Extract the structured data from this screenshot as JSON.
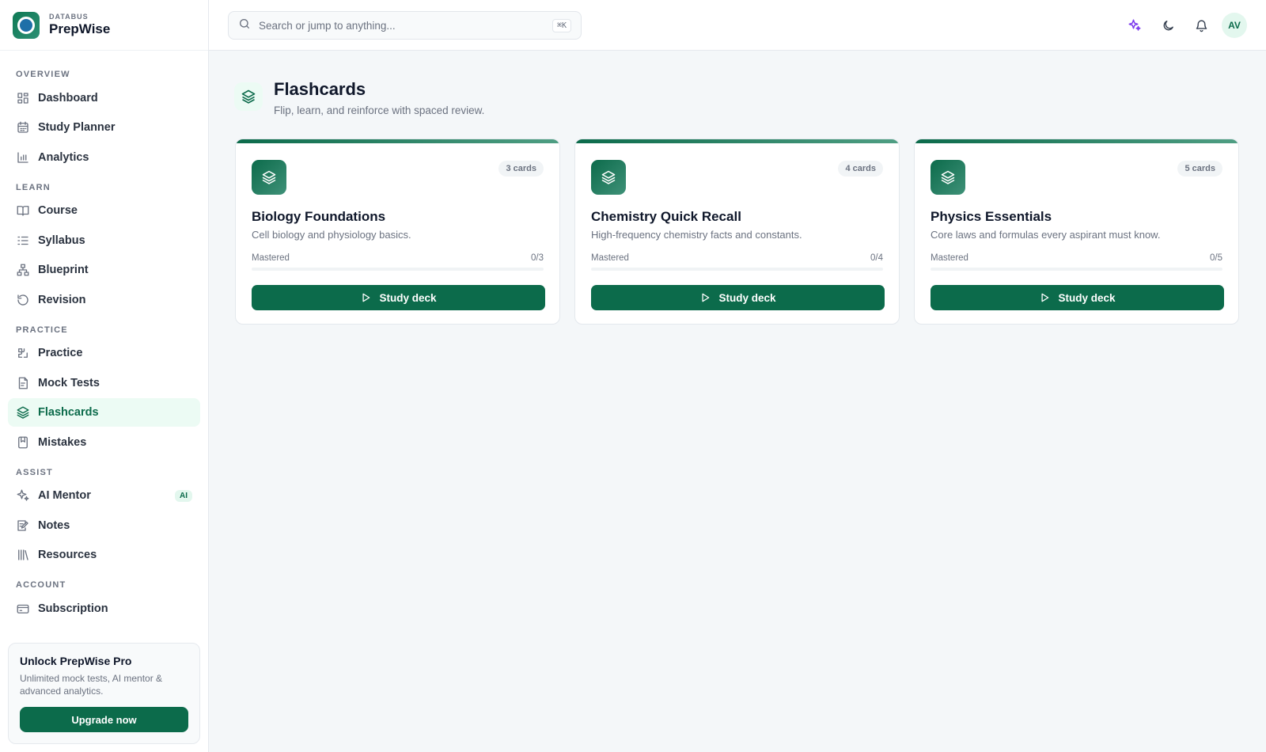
{
  "brand": {
    "kicker": "DATABUS",
    "name": "PrepWise"
  },
  "search": {
    "placeholder": "Search or jump to anything...",
    "shortcut": "⌘K"
  },
  "header": {
    "avatar_initials": "AV",
    "accent_color": "#7c3aed"
  },
  "sidebar": {
    "sections": [
      {
        "title": "OVERVIEW",
        "items": [
          {
            "label": "Dashboard",
            "icon": "dashboard-icon"
          },
          {
            "label": "Study Planner",
            "icon": "calendar-icon"
          },
          {
            "label": "Analytics",
            "icon": "bar-chart-icon"
          }
        ]
      },
      {
        "title": "LEARN",
        "items": [
          {
            "label": "Course",
            "icon": "book-icon"
          },
          {
            "label": "Syllabus",
            "icon": "list-icon"
          },
          {
            "label": "Blueprint",
            "icon": "sitemap-icon"
          },
          {
            "label": "Revision",
            "icon": "refresh-icon"
          }
        ]
      },
      {
        "title": "PRACTICE",
        "items": [
          {
            "label": "Practice",
            "icon": "puzzle-icon"
          },
          {
            "label": "Mock Tests",
            "icon": "document-icon"
          },
          {
            "label": "Flashcards",
            "icon": "layers-icon",
            "active": true
          },
          {
            "label": "Mistakes",
            "icon": "bookmark-icon"
          }
        ]
      },
      {
        "title": "ASSIST",
        "items": [
          {
            "label": "AI Mentor",
            "icon": "sparkles-icon",
            "badge": "AI"
          },
          {
            "label": "Notes",
            "icon": "note-icon"
          },
          {
            "label": "Resources",
            "icon": "library-icon"
          }
        ]
      },
      {
        "title": "ACCOUNT",
        "items": [
          {
            "label": "Subscription",
            "icon": "credit-card-icon"
          }
        ]
      }
    ]
  },
  "promo": {
    "title": "Unlock PrepWise Pro",
    "text": "Unlimited mock tests, AI mentor & advanced analytics.",
    "button": "Upgrade now"
  },
  "page": {
    "title": "Flashcards",
    "subtitle": "Flip, learn, and reinforce with spaced review."
  },
  "decks": [
    {
      "count": "3 cards",
      "title": "Biology Foundations",
      "desc": "Cell biology and physiology basics.",
      "progress_label": "Mastered",
      "progress_value": "0/3",
      "progress_fraction": 0,
      "button": "Study deck"
    },
    {
      "count": "4 cards",
      "title": "Chemistry Quick Recall",
      "desc": "High-frequency chemistry facts and constants.",
      "progress_label": "Mastered",
      "progress_value": "0/4",
      "progress_fraction": 0,
      "button": "Study deck"
    },
    {
      "count": "5 cards",
      "title": "Physics Essentials",
      "desc": "Core laws and formulas every aspirant must know.",
      "progress_label": "Mastered",
      "progress_value": "0/5",
      "progress_fraction": 0,
      "button": "Study deck"
    }
  ],
  "colors": {
    "primary": "#0c6b4b",
    "active_bg": "#ecfbf4"
  }
}
